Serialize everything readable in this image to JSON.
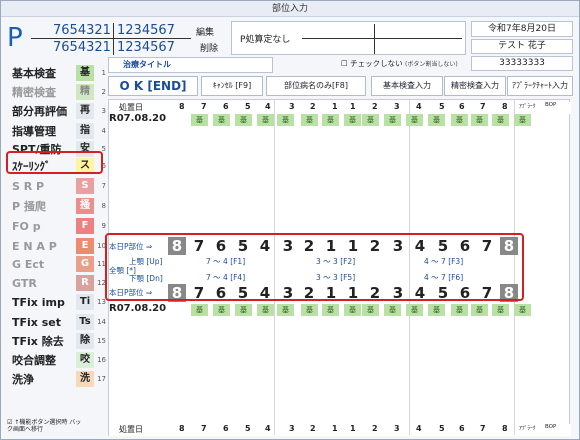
{
  "window": {
    "title": "部位入力"
  },
  "patient": {
    "p_letter": "P",
    "id1": "7654321",
    "id2": "1234567",
    "id3": "7654321",
    "id4": "1234567"
  },
  "header": {
    "edit": "編集",
    "delete": "削除",
    "p_calc": "P処算定なし",
    "date": "令和7年8月20日",
    "name": "テスト 花子",
    "code": "33333333",
    "check_label": "チェックしない",
    "check_note": "(ボタン割当しない)"
  },
  "toolbar": {
    "treat_title": "治療タイトル",
    "ok_end": "O K [END]",
    "cancel": "ｷｬﾝｾﾙ [F9]",
    "only_name": "部位病名のみ[F8]",
    "basic_input": "基本検査入力",
    "detail_input": "精密検査入力",
    "apply_chart": "ｱﾌﾟﾗｰｸﾁｬｰﾄ入力"
  },
  "sidebar": {
    "items": [
      {
        "label": "基本検査",
        "badge": "基",
        "n": "1",
        "color": "#b9e0a5",
        "fg": "#222"
      },
      {
        "label": "精密検査",
        "badge": "精",
        "n": "2",
        "color": "#cfe8c2",
        "fg": "#888"
      },
      {
        "label": "部分再評価",
        "badge": "再",
        "n": "3",
        "color": "#e3e8ef",
        "fg": "#222"
      },
      {
        "label": "指導管理",
        "badge": "指",
        "n": "4",
        "color": "#e3e8ef",
        "fg": "#222"
      },
      {
        "label": "SPT/重防",
        "badge": "安",
        "n": "5",
        "color": "#e3e8ef",
        "fg": "#222"
      },
      {
        "label": "ｽｹｰﾘﾝｸﾞ",
        "badge": "ス",
        "n": "6",
        "color": "#fff5a0",
        "fg": "#222"
      },
      {
        "label": "S R P",
        "badge": "S",
        "n": "7",
        "color": "#e9a0a0",
        "fg": "#fff"
      },
      {
        "label": "P 掻爬",
        "badge": "掻",
        "n": "8",
        "color": "#ec8e8e",
        "fg": "#fff"
      },
      {
        "label": "FO p",
        "badge": "F",
        "n": "9",
        "color": "#ee8080",
        "fg": "#fff"
      },
      {
        "label": "E N A P",
        "badge": "E",
        "n": "10",
        "color": "#ea8b72",
        "fg": "#fff"
      },
      {
        "label": "G Ect",
        "badge": "G",
        "n": "11",
        "color": "#e8a08a",
        "fg": "#fff"
      },
      {
        "label": "GTR",
        "badge": "R",
        "n": "12",
        "color": "#dba0a0",
        "fg": "#fff"
      },
      {
        "label": "TFix imp",
        "badge": "Ti",
        "n": "13",
        "color": "#e3e8ef",
        "fg": "#222"
      },
      {
        "label": "TFix set",
        "badge": "Ts",
        "n": "14",
        "color": "#e3e8ef",
        "fg": "#222"
      },
      {
        "label": "TFix 除去",
        "badge": "除",
        "n": "15",
        "color": "#e3e8ef",
        "fg": "#222"
      },
      {
        "label": "咬合調整",
        "badge": "咬",
        "n": "16",
        "color": "#d9efd9",
        "fg": "#222"
      },
      {
        "label": "洗浄",
        "badge": "洗",
        "n": "17",
        "color": "#f5d9b8",
        "fg": "#222"
      }
    ]
  },
  "footer": {
    "option": "↑機能ボタン選択時 バック画面へ移行"
  },
  "grid": {
    "date_hdr": "処置日",
    "teeth": [
      "8",
      "7",
      "6",
      "5",
      "4",
      "3",
      "2",
      "1",
      "1",
      "2",
      "3",
      "4",
      "5",
      "6",
      "7",
      "8"
    ],
    "apl": "ｱﾌﾟﾗｰｸ",
    "bop": "BOP",
    "row1_date": "R07.08.20",
    "row2_date": "R07.08.20",
    "mark": "基"
  },
  "today": {
    "label": "本日P部位 ⇒",
    "full": "全顎 [*]",
    "up": "上顎 [Up]",
    "down": "下顎 [Dn]",
    "upper": [
      "7 ～ 4  [F1]",
      "3 ～ 3  [F2]",
      "4 ～ 7  [F3]"
    ],
    "lower": [
      "7 ～ 4  [F4]",
      "3 ～ 3  [F5]",
      "4 ～ 7  [F6]"
    ]
  }
}
